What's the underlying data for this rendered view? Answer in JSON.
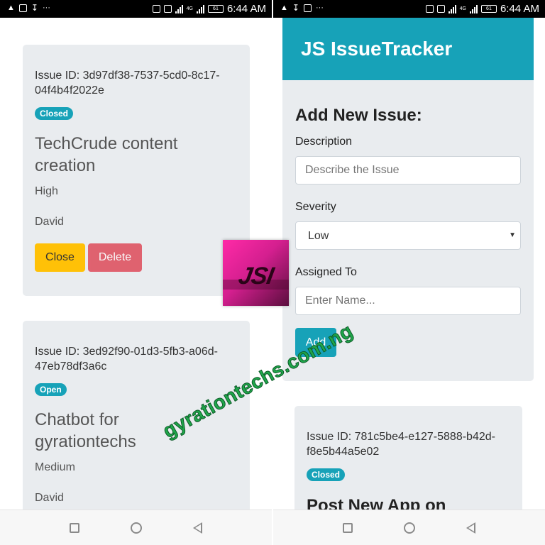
{
  "status_bar": {
    "time": "6:44 AM",
    "network": "4G",
    "battery": "61"
  },
  "left": {
    "issues": [
      {
        "id_line1": "Issue ID: 3d97df38-7537-5cd0-8c17-",
        "id_line2": "04f4b4f2022e",
        "status": "Closed",
        "title_line1": "TechCrude content",
        "title_line2": "creation",
        "severity": "High",
        "assignee": "David",
        "close_label": "Close",
        "delete_label": "Delete"
      },
      {
        "id_line1": "Issue ID: 3ed92f90-01d3-5fb3-a06d-",
        "id_line2": "47eb78df3a6c",
        "status": "Open",
        "title_line1": "Chatbot for",
        "title_line2": "gyrationtechs",
        "severity": "Medium",
        "assignee": "David"
      }
    ]
  },
  "right": {
    "app_title": "JS IssueTracker",
    "form": {
      "heading": "Add New Issue:",
      "description_label": "Description",
      "description_placeholder": "Describe the Issue",
      "severity_label": "Severity",
      "severity_value": "Low",
      "assigned_label": "Assigned To",
      "assigned_placeholder": "Enter Name...",
      "add_label": "Add"
    },
    "issues": [
      {
        "id_line1": "Issue ID: 781c5be4-e127-5888-b42d-",
        "id_line2": "f8e5b44a5e02",
        "status": "Closed",
        "title_partial": "Post New App on"
      }
    ]
  },
  "overlay": {
    "watermark": "gyrationtechs.com.ng",
    "logo_text": "JSI"
  },
  "colors": {
    "accent": "#17a2b8",
    "card": "#e9ecef",
    "warning": "#ffc107",
    "danger": "#dc3545",
    "watermark": "#1fa64a",
    "logo": "#e0239b"
  }
}
